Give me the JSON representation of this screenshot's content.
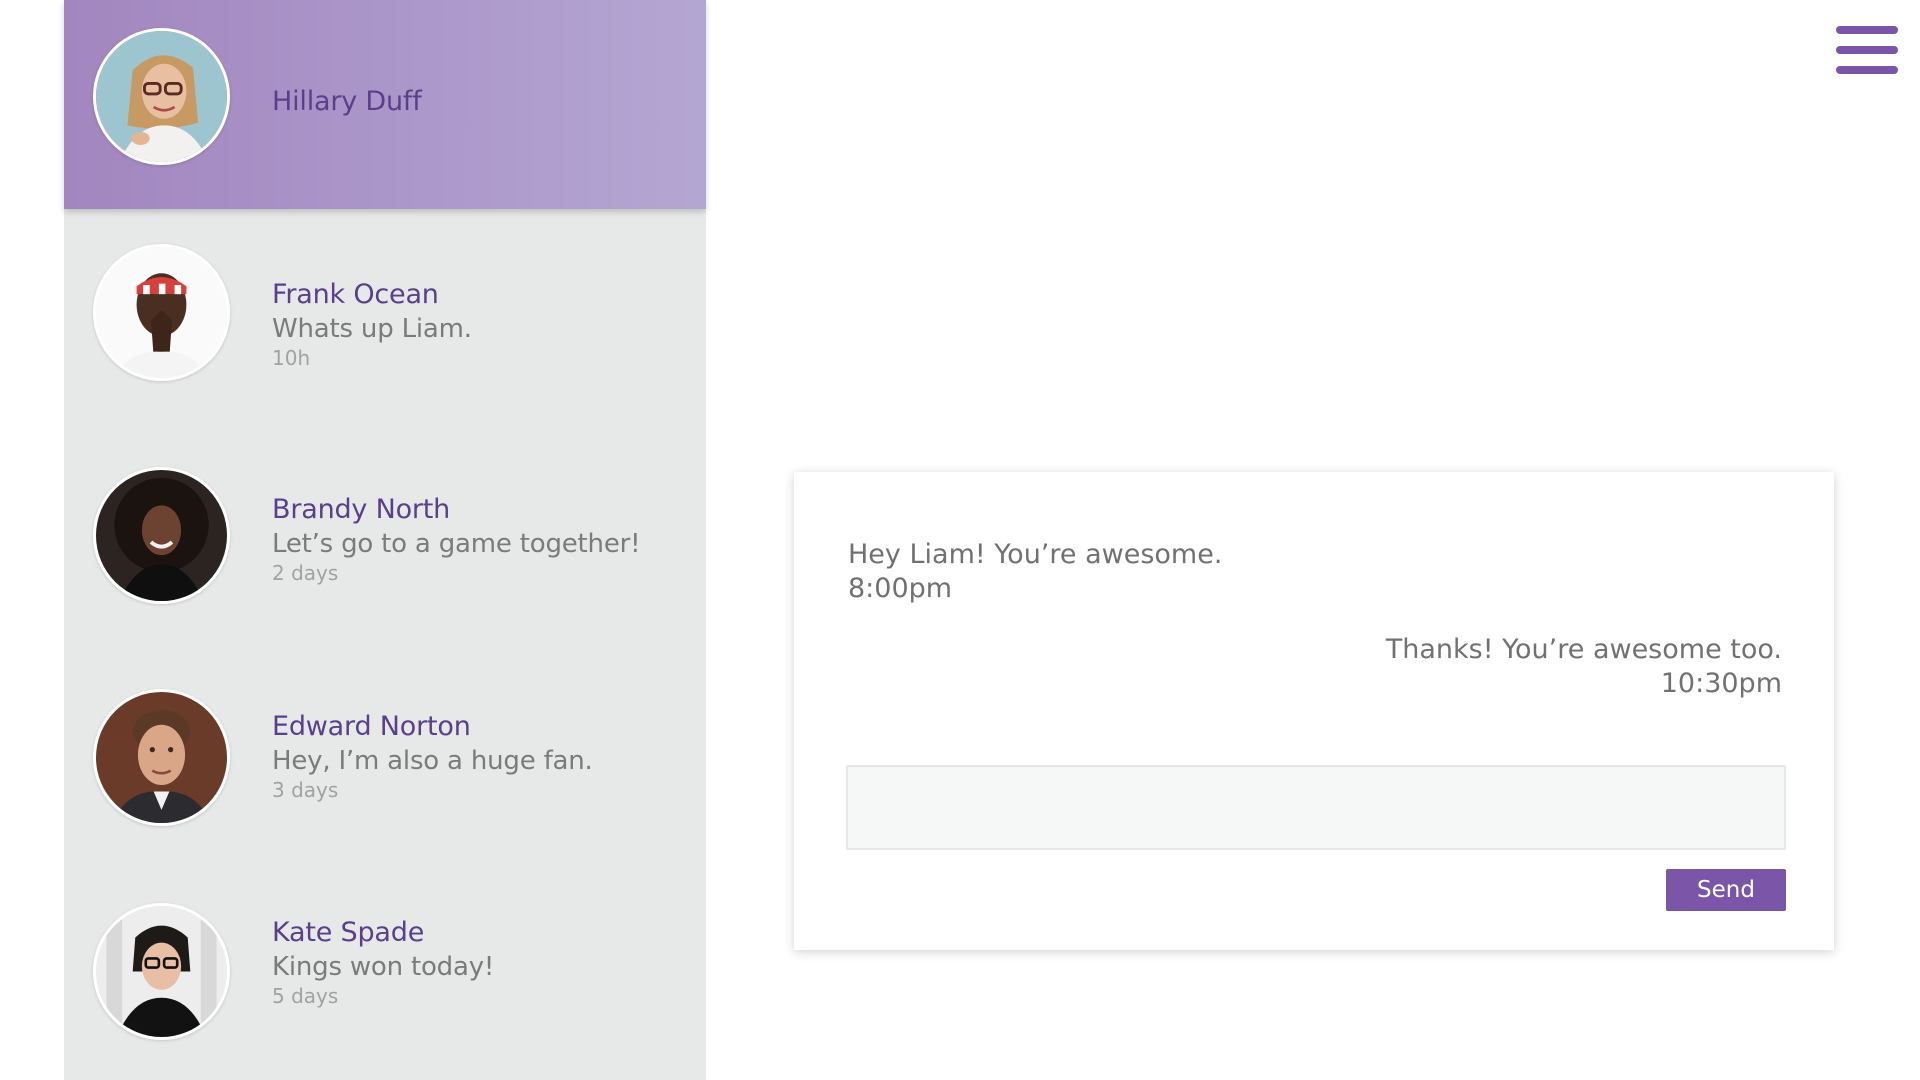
{
  "sidebar": {
    "contacts": [
      {
        "name": "Hillary Duff",
        "message": "",
        "time": "",
        "active": true,
        "avatar": "portrait-woman-glasses"
      },
      {
        "name": "Frank Ocean",
        "message": "Whats up Liam.",
        "time": "10h",
        "active": false,
        "avatar": "portrait-man-headband"
      },
      {
        "name": "Brandy North",
        "message": "Let’s go to a game together!",
        "time": "2 days",
        "active": false,
        "avatar": "portrait-woman-curly-hair"
      },
      {
        "name": "Edward Norton",
        "message": "Hey, I’m also a huge fan.",
        "time": "3 days",
        "active": false,
        "avatar": "portrait-man"
      },
      {
        "name": "Kate Spade",
        "message": "Kings won today!",
        "time": "5 days",
        "active": false,
        "avatar": "portrait-woman-bob-glasses"
      }
    ]
  },
  "header": {
    "menu_icon": "hamburger-menu-icon"
  },
  "chat": {
    "messages": [
      {
        "direction": "incoming",
        "text": "Hey Liam! You’re awesome.",
        "time": "8:00pm"
      },
      {
        "direction": "outgoing",
        "text": "Thanks! You’re awesome too.",
        "time": "10:30pm"
      }
    ],
    "input_value": "",
    "send_label": "Send"
  },
  "colors": {
    "accent": "#7a55a8",
    "active_gradient_start": "#a286bf",
    "active_gradient_end": "#b4a6d3",
    "sidebar_bg": "#e7e8e8",
    "name_text": "#5a3f8a"
  }
}
